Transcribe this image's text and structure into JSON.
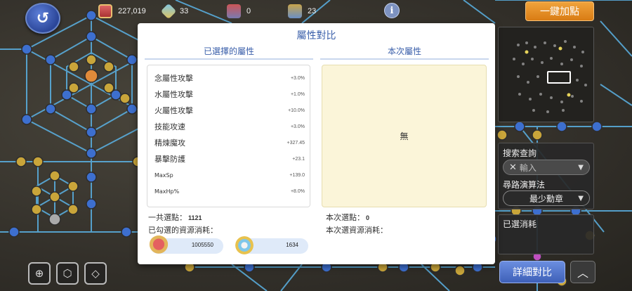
{
  "topbar": {
    "resources": [
      {
        "icon": "medal-icon",
        "value": "227,019"
      },
      {
        "icon": "gem-icon",
        "value": "33"
      },
      {
        "icon": "chest-icon",
        "value": "0"
      },
      {
        "icon": "box-icon",
        "value": "23"
      }
    ],
    "info_label": "i"
  },
  "autoadd_label": "一鍵加點",
  "modal": {
    "title": "屬性對比",
    "selected_header": "已選擇的屬性",
    "current_header": "本次屬性",
    "attributes": [
      {
        "name": "念屬性攻擊",
        "value": "+3.0%"
      },
      {
        "name": "水屬性攻擊",
        "value": "+1.0%"
      },
      {
        "name": "火屬性攻擊",
        "value": "+10.0%"
      },
      {
        "name": "技能攻速",
        "value": "+3.0%"
      },
      {
        "name": "精煉魔攻",
        "value": "+327.45"
      },
      {
        "name": "暴擊防護",
        "value": "+23.1"
      },
      {
        "name": "MaxSp",
        "value": "+139.0"
      },
      {
        "name": "MaxHp%",
        "value": "+8.0%"
      }
    ],
    "current_empty": "無",
    "total_points_label": "一共選點：",
    "total_points_value": "1121",
    "checked_cost_label": "已勾選的資源消耗：",
    "current_points_label": "本次選點：",
    "current_points_value": "0",
    "current_cost_label": "本次選資源消耗：",
    "cost_medal": "1005550",
    "cost_gem": "1634"
  },
  "side": {
    "search_label": "搜索查詢",
    "search_placeholder": "輸入",
    "algo_label": "尋路演算法",
    "algo_value": "最少勳章",
    "selected_cost_label": "已選消耗",
    "detail_label": "詳細對比"
  },
  "colors": {
    "accent_blue": "#3a5faa",
    "orange_button": "#e38d22",
    "empty_panel": "#fbf5d9"
  }
}
